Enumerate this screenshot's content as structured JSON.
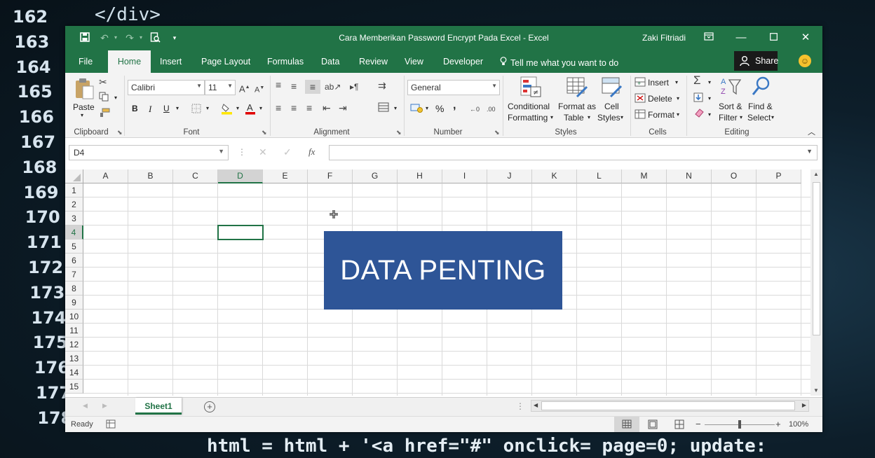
{
  "background": {
    "line_numbers": [
      "162",
      "163",
      "164",
      "165",
      "166",
      "167",
      "168",
      "169",
      "170",
      "171",
      "172",
      "173",
      "174",
      "175",
      "176",
      "177",
      "178"
    ],
    "code_top": "</div>",
    "code_bottom": "html = html + '<a href=\"#\" onclick= page=0; update:"
  },
  "titlebar": {
    "title": "Cara Memberikan Password Encrypt Pada Excel  -  Excel",
    "user": "Zaki Fitriadi"
  },
  "tabs": {
    "file": "File",
    "home": "Home",
    "insert": "Insert",
    "page_layout": "Page Layout",
    "formulas": "Formulas",
    "data": "Data",
    "review": "Review",
    "view": "View",
    "developer": "Developer",
    "tell_me": "Tell me what you want to do",
    "share": "Share"
  },
  "ribbon": {
    "clipboard": {
      "paste": "Paste",
      "label": "Clipboard"
    },
    "font": {
      "name": "Calibri",
      "size": "11",
      "bold": "B",
      "italic": "I",
      "underline": "U",
      "label": "Font"
    },
    "alignment": {
      "label": "Alignment"
    },
    "number": {
      "format": "General",
      "percent": "%",
      "comma": ",",
      "label": "Number"
    },
    "styles": {
      "conditional_1": "Conditional",
      "conditional_2": "Formatting",
      "format_table_1": "Format as",
      "format_table_2": "Table",
      "cell_styles_1": "Cell",
      "cell_styles_2": "Styles",
      "label": "Styles"
    },
    "cells": {
      "insert": "Insert",
      "delete": "Delete",
      "format": "Format",
      "label": "Cells"
    },
    "editing": {
      "sort_1": "Sort &",
      "sort_2": "Filter",
      "find_1": "Find &",
      "find_2": "Select",
      "label": "Editing"
    }
  },
  "formula_bar": {
    "name_box": "D4",
    "formula": "",
    "fx": "fx"
  },
  "grid": {
    "columns": [
      "A",
      "B",
      "C",
      "D",
      "E",
      "F",
      "G",
      "H",
      "I",
      "J",
      "K",
      "L",
      "M",
      "N",
      "O",
      "P"
    ],
    "rows": [
      "1",
      "2",
      "3",
      "4",
      "5",
      "6",
      "7",
      "8",
      "9",
      "10",
      "11",
      "12",
      "13",
      "14",
      "15"
    ],
    "selected_cell": "D4"
  },
  "shape": {
    "text": "DATA PENTING",
    "color": "#2e5597"
  },
  "sheets": {
    "active": "Sheet1"
  },
  "status": {
    "mode": "Ready",
    "zoom": "100%"
  },
  "colors": {
    "accent": "#217346"
  }
}
